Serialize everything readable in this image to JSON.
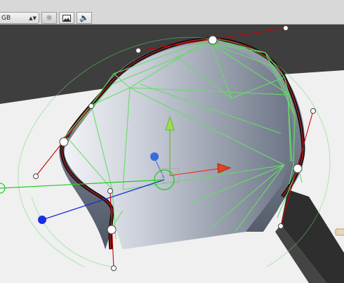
{
  "toolbar": {
    "render_mode_value": "GB",
    "buttons": [
      {
        "name": "lighting-toggle-button",
        "icon": "sun-icon",
        "active": true
      },
      {
        "name": "image-effects-button",
        "icon": "image-icon",
        "active": false
      },
      {
        "name": "audio-toggle-button",
        "icon": "speaker-icon",
        "active": false
      }
    ]
  },
  "scene": {
    "background_color": "#f0f0f0",
    "horizon_color": "#3e3e3e",
    "shape_fill_light": "#e9ecf2",
    "shape_fill_dark": "#7a8394",
    "outline_color": "#111111",
    "outline_highlight": "#cc2222",
    "wireframe_color": "#66dd66",
    "tangent_color": "#cc0000",
    "gizmo": {
      "x_axis_color": "#e03a1a",
      "y_axis_color": "#8fe03a",
      "z_axis_color": "#3a6ae0"
    }
  }
}
